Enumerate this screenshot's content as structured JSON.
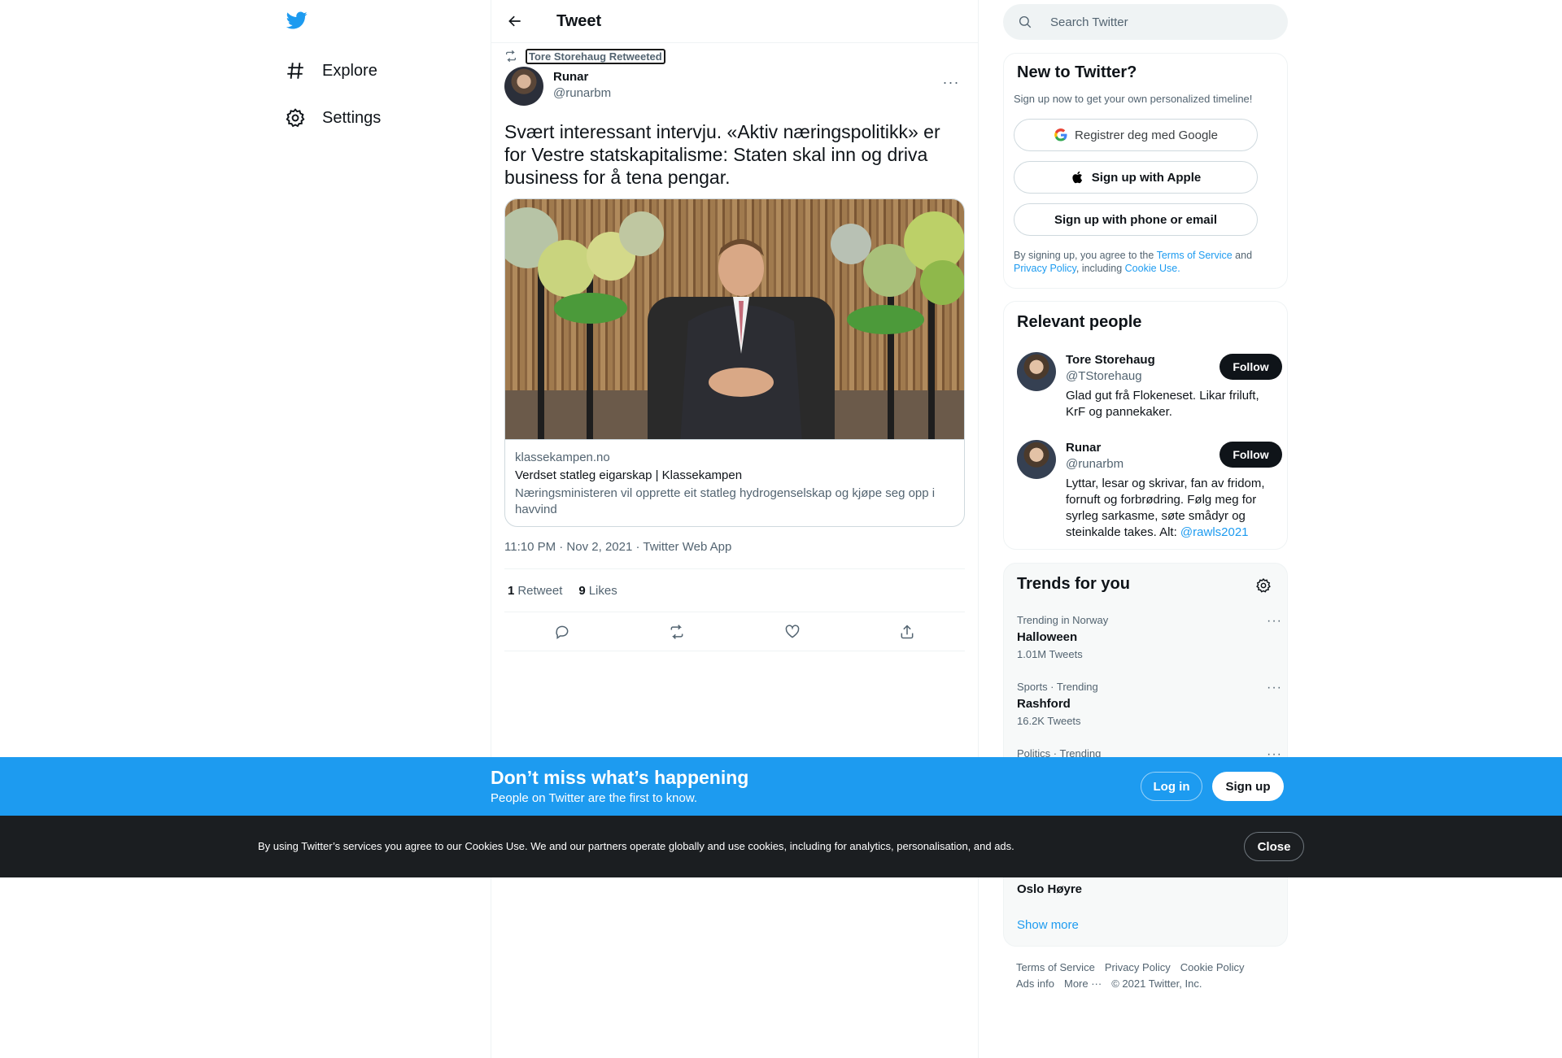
{
  "nav": {
    "explore": "Explore",
    "settings": "Settings"
  },
  "header": {
    "title": "Tweet"
  },
  "tweet": {
    "retweeted_by": "Tore Storehaug Retweeted",
    "author_name": "Runar",
    "author_handle": "@runarbm",
    "more": "···",
    "text": "Svært interessant intervju. «Aktiv næringspolitikk» er for Vestre statskapitalisme: Staten skal inn og driva business for å tena pengar.",
    "card": {
      "domain": "klassekampen.no",
      "title": "Verdset statleg eigarskap | Klassekampen",
      "description": "Næringsministeren vil opprette eit statleg hydrogenselskap og kjøpe seg opp i havvind"
    },
    "timestamp": "11:10 PM · Nov 2, 2021 · Twitter Web App",
    "retweets_count": "1",
    "retweets_label": "Retweet",
    "likes_count": "9",
    "likes_label": "Likes"
  },
  "search": {
    "placeholder": "Search Twitter"
  },
  "new_to_twitter": {
    "title": "New to Twitter?",
    "subtitle": "Sign up now to get your own personalized timeline!",
    "google": "Registrer deg med Google",
    "apple": "Sign up with Apple",
    "phone": "Sign up with phone or email",
    "terms_1": "By signing up, you agree to the ",
    "terms_tos": "Terms of Service",
    "terms_2": " and ",
    "terms_privacy": "Privacy Policy",
    "terms_3": ", including ",
    "terms_cookie": "Cookie Use."
  },
  "relevant_people": {
    "title": "Relevant people",
    "follow_label": "Follow",
    "people": [
      {
        "name": "Tore Storehaug",
        "handle": "@TStorehaug",
        "bio": "Glad gut frå Flokeneset. Likar friluft, KrF og pannekaker."
      },
      {
        "name": "Runar",
        "handle": "@runarbm",
        "bio": "Lyttar, lesar og skrivar, fan av fridom, fornuft og forbrødring. Følg meg for syrleg sarkasme, søte smådyr og steinkalde takes. Alt: ",
        "bio_link": "@rawls2021"
      }
    ]
  },
  "trends": {
    "title": "Trends for you",
    "more": "···",
    "items": [
      {
        "context": "Trending in Norway",
        "name": "Halloween",
        "count": "1.01M Tweets"
      },
      {
        "context": "Sports · Trending",
        "name": "Rashford",
        "count": "16.2K Tweets"
      },
      {
        "context": "Politics · Trending"
      },
      {
        "name": "Oslo Høyre"
      }
    ],
    "show_more": "Show more"
  },
  "footer": {
    "terms": "Terms of Service",
    "privacy": "Privacy Policy",
    "cookie": "Cookie Policy",
    "ads": "Ads info",
    "more": "More ···",
    "copyright": "© 2021 Twitter, Inc."
  },
  "signup_bar": {
    "title": "Don’t miss what’s happening",
    "subtitle": "People on Twitter are the first to know.",
    "login": "Log in",
    "signup": "Sign up"
  },
  "cookie_bar": {
    "text": "By using Twitter’s services you agree to our Cookies Use. We and our partners operate globally and use cookies, including for analytics, personalisation, and ads.",
    "close": "Close"
  },
  "colors": {
    "accent": "#1d9bf0",
    "text": "#0f1419",
    "secondary": "#536471",
    "cookie_bg": "#1b1e21"
  }
}
